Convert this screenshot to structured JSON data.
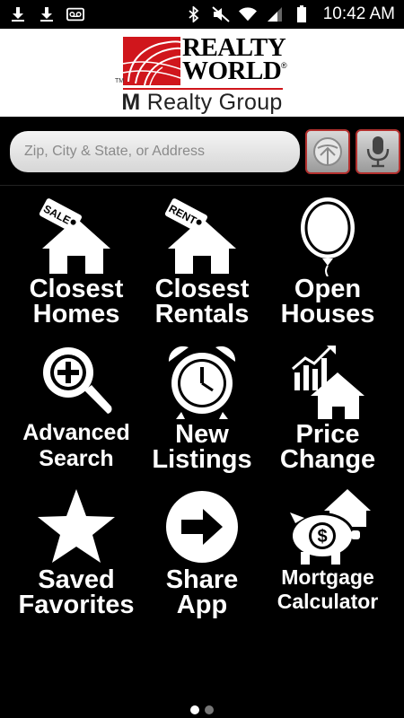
{
  "status_bar": {
    "time": "10:42 AM",
    "left_icons": [
      "download-icon",
      "download-icon",
      "voicemail-icon"
    ],
    "right_icons": [
      "bluetooth-icon",
      "mute-icon",
      "wifi-icon",
      "signal-icon",
      "battery-icon"
    ]
  },
  "header": {
    "logo_line1": "REALTY",
    "logo_line2": "WORLD",
    "trademark": "TM",
    "registered": "®",
    "sub_brand_initial": "M",
    "sub_brand_rest": " Realty Group",
    "brand_red": "#d0161c"
  },
  "search": {
    "placeholder": "Zip, City & State, or Address",
    "value": "",
    "locate_icon": "gps-locate-icon",
    "mic_icon": "microphone-icon"
  },
  "menu": {
    "closest_homes": {
      "line1": "Closest",
      "line2": "Homes",
      "icon": "sale-house-icon",
      "tag": "SALE"
    },
    "closest_rentals": {
      "line1": "Closest",
      "line2": "Rentals",
      "icon": "rent-house-icon",
      "tag": "RENT"
    },
    "open_houses": {
      "line1": "Open",
      "line2": "Houses",
      "icon": "balloon-icon"
    },
    "advanced_search": {
      "line1": "Advanced",
      "line2": "Search",
      "icon": "magnifier-plus-icon"
    },
    "new_listings": {
      "line1": "New",
      "line2": "Listings",
      "icon": "alarm-clock-icon"
    },
    "price_change": {
      "line1": "Price",
      "line2": "Change",
      "icon": "chart-house-icon"
    },
    "saved_favorites": {
      "line1": "Saved",
      "line2": "Favorites",
      "icon": "star-icon"
    },
    "share_app": {
      "line1": "Share",
      "line2": "App",
      "icon": "arrow-right-circle-icon"
    },
    "mortgage_calculator": {
      "line1": "Mortgage",
      "line2": "Calculator",
      "icon": "piggy-bank-house-icon",
      "symbol": "$"
    }
  },
  "pager": {
    "current_page": 1,
    "total_pages": 2
  }
}
